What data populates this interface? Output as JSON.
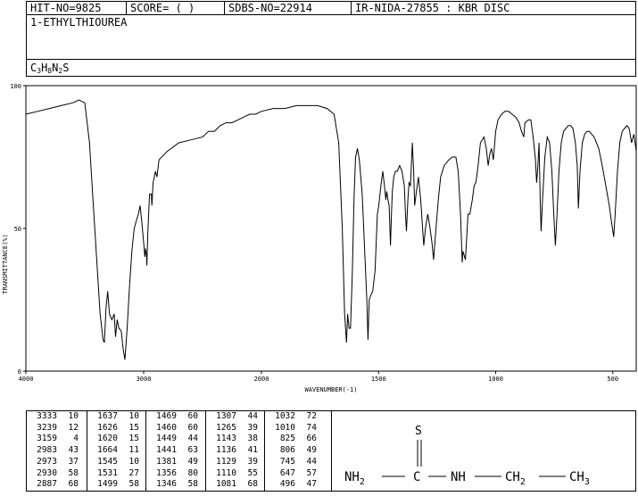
{
  "header": {
    "hit_no": "HIT-NO=9825",
    "score": "SCORE=  (  )",
    "sdbs_no": "SDBS-NO=22914",
    "ir_nida": "IR-NIDA-27855 : KBR DISC"
  },
  "compound_name": "1-ETHYLTHIOUREA",
  "formula": {
    "c": "C",
    "c_n": "3",
    "h": "H",
    "h_n": "8",
    "n": "N",
    "n_n": "2",
    "s": "S"
  },
  "chart_data": {
    "type": "line",
    "xlabel": "WAVENUMBER(-1)",
    "ylabel": "TRANSMITTANCE(%)",
    "xlim": [
      4000,
      400
    ],
    "ylim": [
      0,
      100
    ],
    "x_ticks": [
      "4000",
      "3000",
      "2000",
      "1500",
      "1000",
      "500"
    ],
    "y_ticks": [
      "0",
      "50",
      "100"
    ],
    "series": [
      {
        "points": [
          [
            4000,
            90
          ],
          [
            3900,
            91
          ],
          [
            3800,
            92
          ],
          [
            3700,
            93
          ],
          [
            3600,
            94
          ],
          [
            3550,
            95
          ],
          [
            3500,
            94
          ],
          [
            3460,
            80
          ],
          [
            3430,
            60
          ],
          [
            3400,
            40
          ],
          [
            3370,
            20
          ],
          [
            3345,
            11
          ],
          [
            3333,
            10
          ],
          [
            3320,
            22
          ],
          [
            3305,
            28
          ],
          [
            3290,
            20
          ],
          [
            3270,
            18
          ],
          [
            3250,
            20
          ],
          [
            3239,
            12
          ],
          [
            3225,
            18
          ],
          [
            3210,
            15
          ],
          [
            3190,
            14
          ],
          [
            3175,
            8
          ],
          [
            3159,
            4
          ],
          [
            3140,
            15
          ],
          [
            3120,
            30
          ],
          [
            3100,
            42
          ],
          [
            3080,
            50
          ],
          [
            3060,
            53
          ],
          [
            3045,
            55
          ],
          [
            3030,
            58
          ],
          [
            3015,
            52
          ],
          [
            3000,
            45
          ],
          [
            2990,
            40
          ],
          [
            2983,
            43
          ],
          [
            2975,
            40
          ],
          [
            2973,
            37
          ],
          [
            2965,
            48
          ],
          [
            2950,
            62
          ],
          [
            2935,
            62
          ],
          [
            2930,
            58
          ],
          [
            2920,
            66
          ],
          [
            2900,
            70
          ],
          [
            2887,
            68
          ],
          [
            2870,
            74
          ],
          [
            2800,
            77
          ],
          [
            2700,
            80
          ],
          [
            2600,
            81
          ],
          [
            2500,
            82
          ],
          [
            2450,
            84
          ],
          [
            2400,
            84
          ],
          [
            2350,
            86
          ],
          [
            2300,
            87
          ],
          [
            2250,
            87
          ],
          [
            2200,
            88
          ],
          [
            2150,
            89
          ],
          [
            2100,
            90
          ],
          [
            2050,
            90
          ],
          [
            2000,
            91
          ],
          [
            1950,
            92
          ],
          [
            1900,
            92
          ],
          [
            1850,
            93
          ],
          [
            1800,
            93
          ],
          [
            1760,
            93
          ],
          [
            1720,
            92
          ],
          [
            1690,
            90
          ],
          [
            1670,
            80
          ],
          [
            1655,
            50
          ],
          [
            1645,
            20
          ],
          [
            1637,
            10
          ],
          [
            1632,
            20
          ],
          [
            1626,
            15
          ],
          [
            1620,
            15
          ],
          [
            1612,
            35
          ],
          [
            1605,
            60
          ],
          [
            1598,
            75
          ],
          [
            1590,
            78
          ],
          [
            1582,
            74
          ],
          [
            1570,
            62
          ],
          [
            1558,
            40
          ],
          [
            1550,
            25
          ],
          [
            1545,
            11
          ],
          [
            1540,
            25
          ],
          [
            1531,
            27
          ],
          [
            1525,
            28
          ],
          [
            1515,
            35
          ],
          [
            1505,
            55
          ],
          [
            1499,
            58
          ],
          [
            1490,
            65
          ],
          [
            1482,
            70
          ],
          [
            1475,
            65
          ],
          [
            1469,
            60
          ],
          [
            1465,
            63
          ],
          [
            1460,
            60
          ],
          [
            1455,
            58
          ],
          [
            1449,
            44
          ],
          [
            1445,
            55
          ],
          [
            1441,
            63
          ],
          [
            1435,
            68
          ],
          [
            1428,
            70
          ],
          [
            1420,
            70
          ],
          [
            1410,
            72
          ],
          [
            1400,
            70
          ],
          [
            1390,
            65
          ],
          [
            1385,
            55
          ],
          [
            1381,
            49
          ],
          [
            1375,
            60
          ],
          [
            1370,
            66
          ],
          [
            1364,
            65
          ],
          [
            1356,
            80
          ],
          [
            1350,
            70
          ],
          [
            1346,
            58
          ],
          [
            1340,
            62
          ],
          [
            1330,
            68
          ],
          [
            1320,
            60
          ],
          [
            1312,
            50
          ],
          [
            1307,
            44
          ],
          [
            1300,
            50
          ],
          [
            1290,
            55
          ],
          [
            1280,
            50
          ],
          [
            1272,
            45
          ],
          [
            1265,
            39
          ],
          [
            1255,
            50
          ],
          [
            1245,
            60
          ],
          [
            1235,
            68
          ],
          [
            1220,
            72
          ],
          [
            1200,
            74
          ],
          [
            1185,
            75
          ],
          [
            1170,
            75
          ],
          [
            1160,
            70
          ],
          [
            1150,
            55
          ],
          [
            1143,
            38
          ],
          [
            1140,
            42
          ],
          [
            1136,
            41
          ],
          [
            1129,
            39
          ],
          [
            1125,
            45
          ],
          [
            1118,
            55
          ],
          [
            1110,
            55
          ],
          [
            1100,
            60
          ],
          [
            1092,
            65
          ],
          [
            1085,
            66
          ],
          [
            1081,
            68
          ],
          [
            1075,
            72
          ],
          [
            1065,
            80
          ],
          [
            1050,
            82
          ],
          [
            1040,
            78
          ],
          [
            1032,
            72
          ],
          [
            1025,
            76
          ],
          [
            1018,
            78
          ],
          [
            1010,
            74
          ],
          [
            1000,
            84
          ],
          [
            990,
            88
          ],
          [
            975,
            90
          ],
          [
            960,
            91
          ],
          [
            945,
            91
          ],
          [
            930,
            90
          ],
          [
            915,
            89
          ],
          [
            900,
            87
          ],
          [
            890,
            84
          ],
          [
            880,
            82
          ],
          [
            875,
            87
          ],
          [
            860,
            88
          ],
          [
            850,
            88
          ],
          [
            840,
            82
          ],
          [
            830,
            74
          ],
          [
            825,
            66
          ],
          [
            820,
            72
          ],
          [
            815,
            80
          ],
          [
            810,
            60
          ],
          [
            806,
            49
          ],
          [
            800,
            60
          ],
          [
            790,
            75
          ],
          [
            780,
            82
          ],
          [
            770,
            80
          ],
          [
            760,
            70
          ],
          [
            752,
            55
          ],
          [
            745,
            44
          ],
          [
            740,
            52
          ],
          [
            730,
            70
          ],
          [
            720,
            80
          ],
          [
            710,
            84
          ],
          [
            700,
            85
          ],
          [
            690,
            86
          ],
          [
            680,
            86
          ],
          [
            670,
            85
          ],
          [
            660,
            80
          ],
          [
            652,
            72
          ],
          [
            647,
            57
          ],
          [
            640,
            70
          ],
          [
            630,
            80
          ],
          [
            620,
            83
          ],
          [
            610,
            84
          ],
          [
            600,
            84
          ],
          [
            590,
            83
          ],
          [
            580,
            82
          ],
          [
            570,
            80
          ],
          [
            560,
            78
          ],
          [
            545,
            72
          ],
          [
            530,
            65
          ],
          [
            515,
            58
          ],
          [
            505,
            52
          ],
          [
            496,
            47
          ],
          [
            490,
            55
          ],
          [
            480,
            70
          ],
          [
            470,
            80
          ],
          [
            460,
            84
          ],
          [
            450,
            85
          ],
          [
            440,
            86
          ],
          [
            430,
            85
          ],
          [
            420,
            80
          ],
          [
            410,
            83
          ],
          [
            400,
            77
          ]
        ]
      }
    ]
  },
  "peak_table": [
    [
      [
        "3333",
        "10"
      ],
      [
        "3239",
        "12"
      ],
      [
        "3159",
        "4"
      ],
      [
        "2983",
        "43"
      ],
      [
        "2973",
        "37"
      ],
      [
        "2930",
        "58"
      ],
      [
        "2887",
        "68"
      ]
    ],
    [
      [
        "1637",
        "10"
      ],
      [
        "1626",
        "15"
      ],
      [
        "1620",
        "15"
      ],
      [
        "1664",
        "11"
      ],
      [
        "1545",
        "10"
      ],
      [
        "1531",
        "27"
      ],
      [
        "1499",
        "58"
      ]
    ],
    [
      [
        "1469",
        "60"
      ],
      [
        "1460",
        "60"
      ],
      [
        "1449",
        "44"
      ],
      [
        "1441",
        "63"
      ],
      [
        "1381",
        "49"
      ],
      [
        "1356",
        "80"
      ],
      [
        "1346",
        "58"
      ]
    ],
    [
      [
        "1307",
        "44"
      ],
      [
        "1265",
        "39"
      ],
      [
        "1143",
        "38"
      ],
      [
        "1136",
        "41"
      ],
      [
        "1129",
        "39"
      ],
      [
        "1110",
        "55"
      ],
      [
        "1081",
        "68"
      ]
    ],
    [
      [
        "1032",
        "72"
      ],
      [
        "1010",
        "74"
      ],
      [
        "825",
        "66"
      ],
      [
        "806",
        "49"
      ],
      [
        "745",
        "44"
      ],
      [
        "647",
        "57"
      ],
      [
        "496",
        "47"
      ]
    ]
  ],
  "structure": {
    "s_atom": "S",
    "nh2": "NH",
    "nh2_sub": "2",
    "c_atom": "C",
    "nh": "NH",
    "ch2": "CH",
    "ch2_sub": "2",
    "ch3": "CH",
    "ch3_sub": "3"
  }
}
